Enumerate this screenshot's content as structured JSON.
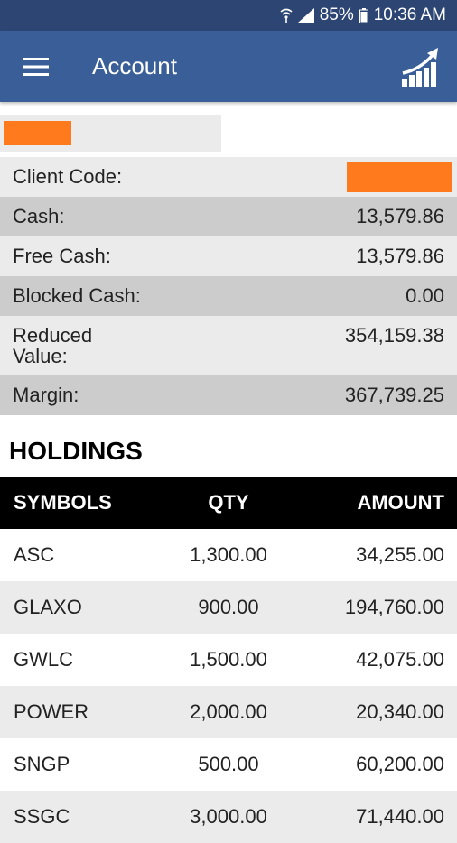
{
  "status_bar": {
    "battery": "85%",
    "time": "10:36 AM"
  },
  "app_bar": {
    "title": "Account"
  },
  "account": {
    "client_code_label": "Client Code:",
    "rows": [
      {
        "label": "Cash:",
        "value": "13,579.86"
      },
      {
        "label": "Free Cash:",
        "value": "13,579.86"
      },
      {
        "label": "Blocked Cash:",
        "value": "0.00"
      },
      {
        "label": "Reduced Value:",
        "value": "354,159.38"
      },
      {
        "label": "Margin:",
        "value": "367,739.25"
      }
    ]
  },
  "holdings": {
    "title": "HOLDINGS",
    "columns": [
      "SYMBOLS",
      "QTY",
      "AMOUNT"
    ],
    "rows": [
      {
        "symbol": "ASC",
        "qty": "1,300.00",
        "amount": "34,255.00"
      },
      {
        "symbol": "GLAXO",
        "qty": "900.00",
        "amount": "194,760.00"
      },
      {
        "symbol": "GWLC",
        "qty": "1,500.00",
        "amount": "42,075.00"
      },
      {
        "symbol": "POWER",
        "qty": "2,000.00",
        "amount": "20,340.00"
      },
      {
        "symbol": "SNGP",
        "qty": "500.00",
        "amount": "60,200.00"
      },
      {
        "symbol": "SSGC",
        "qty": "3,000.00",
        "amount": "71,440.00"
      }
    ]
  },
  "colors": {
    "status_bar": "#2c4573",
    "app_bar": "#3a5f98",
    "redaction": "#ff7a1c"
  },
  "icons": [
    "wifi-icon",
    "signal-icon",
    "battery-icon",
    "menu-icon",
    "trend-chart-icon"
  ]
}
